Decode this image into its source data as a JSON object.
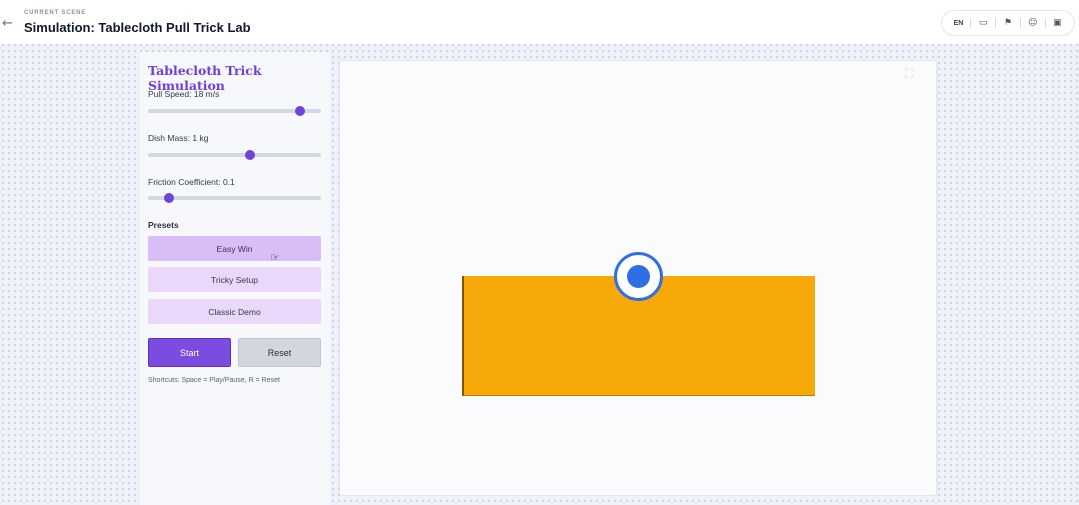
{
  "header": {
    "kicker": "CURRENT SCENE",
    "title": "Simulation: Tablecloth Pull Trick Lab",
    "language": "EN",
    "icons": [
      "back-arrow-icon",
      "monitor-icon",
      "feedback-icon",
      "user-icon",
      "bookmark-icon"
    ]
  },
  "panel": {
    "title": "Tablecloth Trick Simulation",
    "sliders": [
      {
        "label": "Pull Speed: 18 m/s",
        "level": 0.88
      },
      {
        "label": "Dish Mass: 1 kg",
        "level": 0.59
      },
      {
        "label": "Friction Coefficient: 0.1",
        "level": 0.12
      }
    ],
    "presets_heading": "Presets",
    "presets": [
      "Easy Win",
      "Tricky Setup",
      "Classic Demo"
    ],
    "start_label": "Start",
    "reset_label": "Reset",
    "shortcuts": "Shortcuts: Space = Play/Pause, R = Reset"
  },
  "colors": {
    "accent": "#6d3fd8",
    "table": "#f7a90a",
    "dish": "#2f6fe6",
    "preset_bg": "#ead8fb"
  }
}
